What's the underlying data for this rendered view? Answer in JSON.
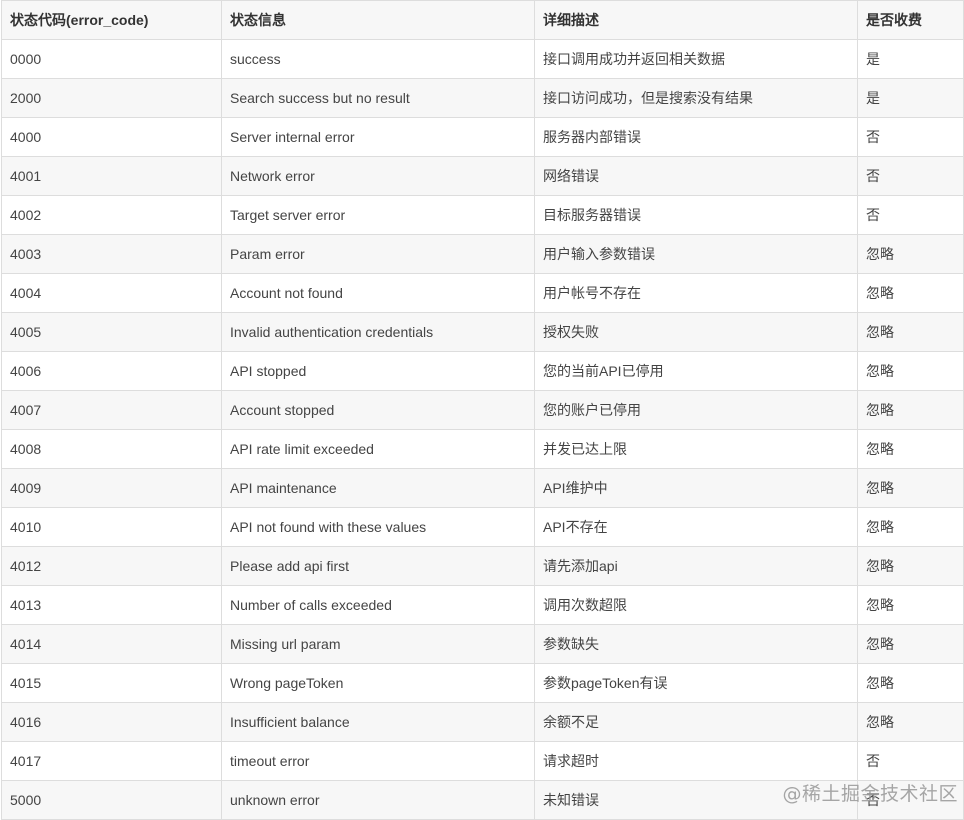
{
  "table": {
    "headers": [
      "状态代码(error_code)",
      "状态信息",
      "详细描述",
      "是否收费"
    ],
    "rows": [
      [
        "0000",
        "success",
        "接口调用成功并返回相关数据",
        "是"
      ],
      [
        "2000",
        "Search success but no result",
        "接口访问成功，但是搜索没有结果",
        "是"
      ],
      [
        "4000",
        "Server internal error",
        "服务器内部错误",
        "否"
      ],
      [
        "4001",
        "Network error",
        "网络错误",
        "否"
      ],
      [
        "4002",
        "Target server error",
        "目标服务器错误",
        "否"
      ],
      [
        "4003",
        "Param error",
        "用户输入参数错误",
        "忽略"
      ],
      [
        "4004",
        "Account not found",
        "用户帐号不存在",
        "忽略"
      ],
      [
        "4005",
        "Invalid authentication credentials",
        "授权失败",
        "忽略"
      ],
      [
        "4006",
        "API stopped",
        "您的当前API已停用",
        "忽略"
      ],
      [
        "4007",
        "Account stopped",
        "您的账户已停用",
        "忽略"
      ],
      [
        "4008",
        "API rate limit exceeded",
        "并发已达上限",
        "忽略"
      ],
      [
        "4009",
        "API maintenance",
        "API维护中",
        "忽略"
      ],
      [
        "4010",
        "API not found with these values",
        "API不存在",
        "忽略"
      ],
      [
        "4012",
        "Please add api first",
        "请先添加api",
        "忽略"
      ],
      [
        "4013",
        "Number of calls exceeded",
        "调用次数超限",
        "忽略"
      ],
      [
        "4014",
        "Missing url param",
        "参数缺失",
        "忽略"
      ],
      [
        "4015",
        "Wrong pageToken",
        "参数pageToken有误",
        "忽略"
      ],
      [
        "4016",
        "Insufficient balance",
        "余额不足",
        "忽略"
      ],
      [
        "4017",
        "timeout error",
        "请求超时",
        "否"
      ],
      [
        "5000",
        "unknown error",
        "未知错误",
        "否"
      ]
    ]
  },
  "watermark": "@稀土掘金技术社区"
}
